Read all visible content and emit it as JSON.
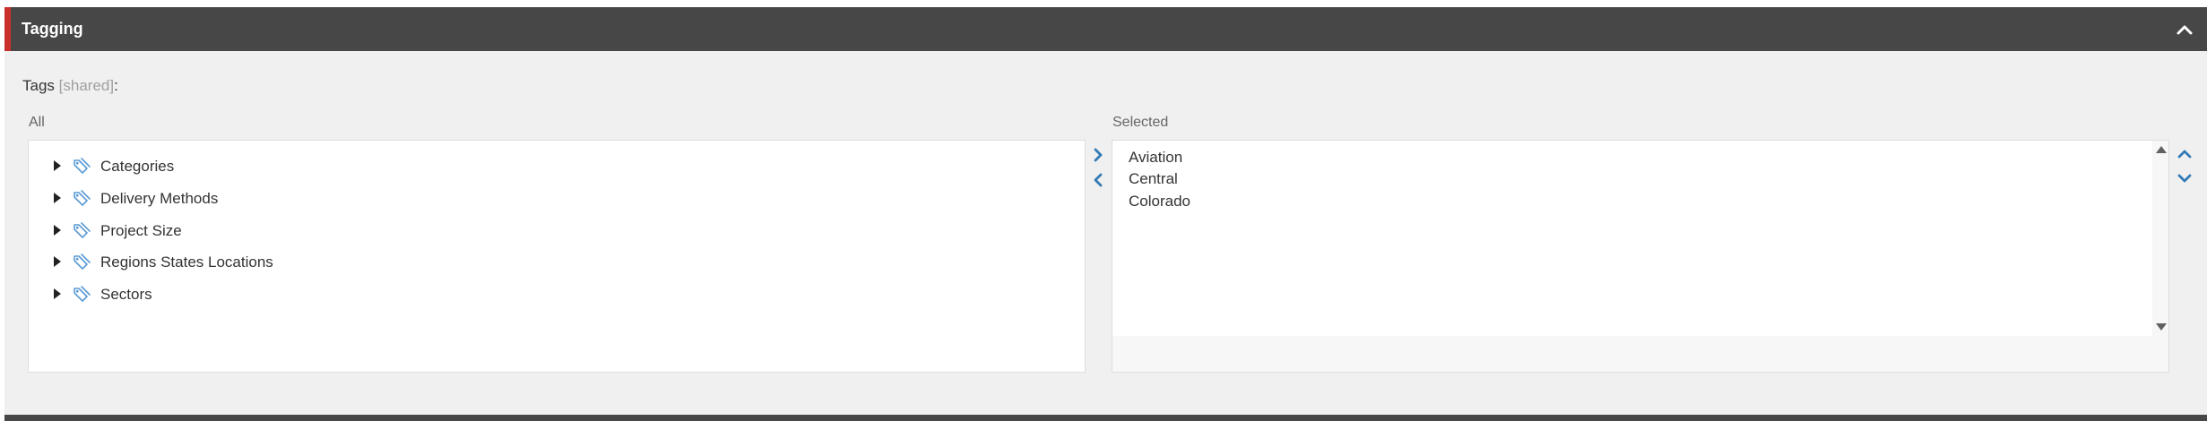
{
  "panel": {
    "title": "Tagging",
    "collapse_icon": "chevron-up-icon",
    "accent_color": "#c9302c",
    "header_color": "#474747"
  },
  "field": {
    "label": "Tags",
    "shared_note": "[shared]",
    "suffix": ":"
  },
  "all_box": {
    "label": "All",
    "items": [
      {
        "label": "Categories",
        "icon": "tag-icon"
      },
      {
        "label": "Delivery Methods",
        "icon": "tag-icon"
      },
      {
        "label": "Project Size",
        "icon": "tag-icon"
      },
      {
        "label": "Regions States Locations",
        "icon": "tag-icon"
      },
      {
        "label": "Sectors",
        "icon": "tag-icon"
      }
    ]
  },
  "transfer": {
    "add_icon": "chevron-right-icon",
    "remove_icon": "chevron-left-icon",
    "color": "#337ab7"
  },
  "selected_box": {
    "label": "Selected",
    "items": [
      "Aviation",
      "Central",
      "Colorado"
    ]
  },
  "reorder": {
    "up_icon": "chevron-up-icon",
    "down_icon": "chevron-down-icon"
  }
}
